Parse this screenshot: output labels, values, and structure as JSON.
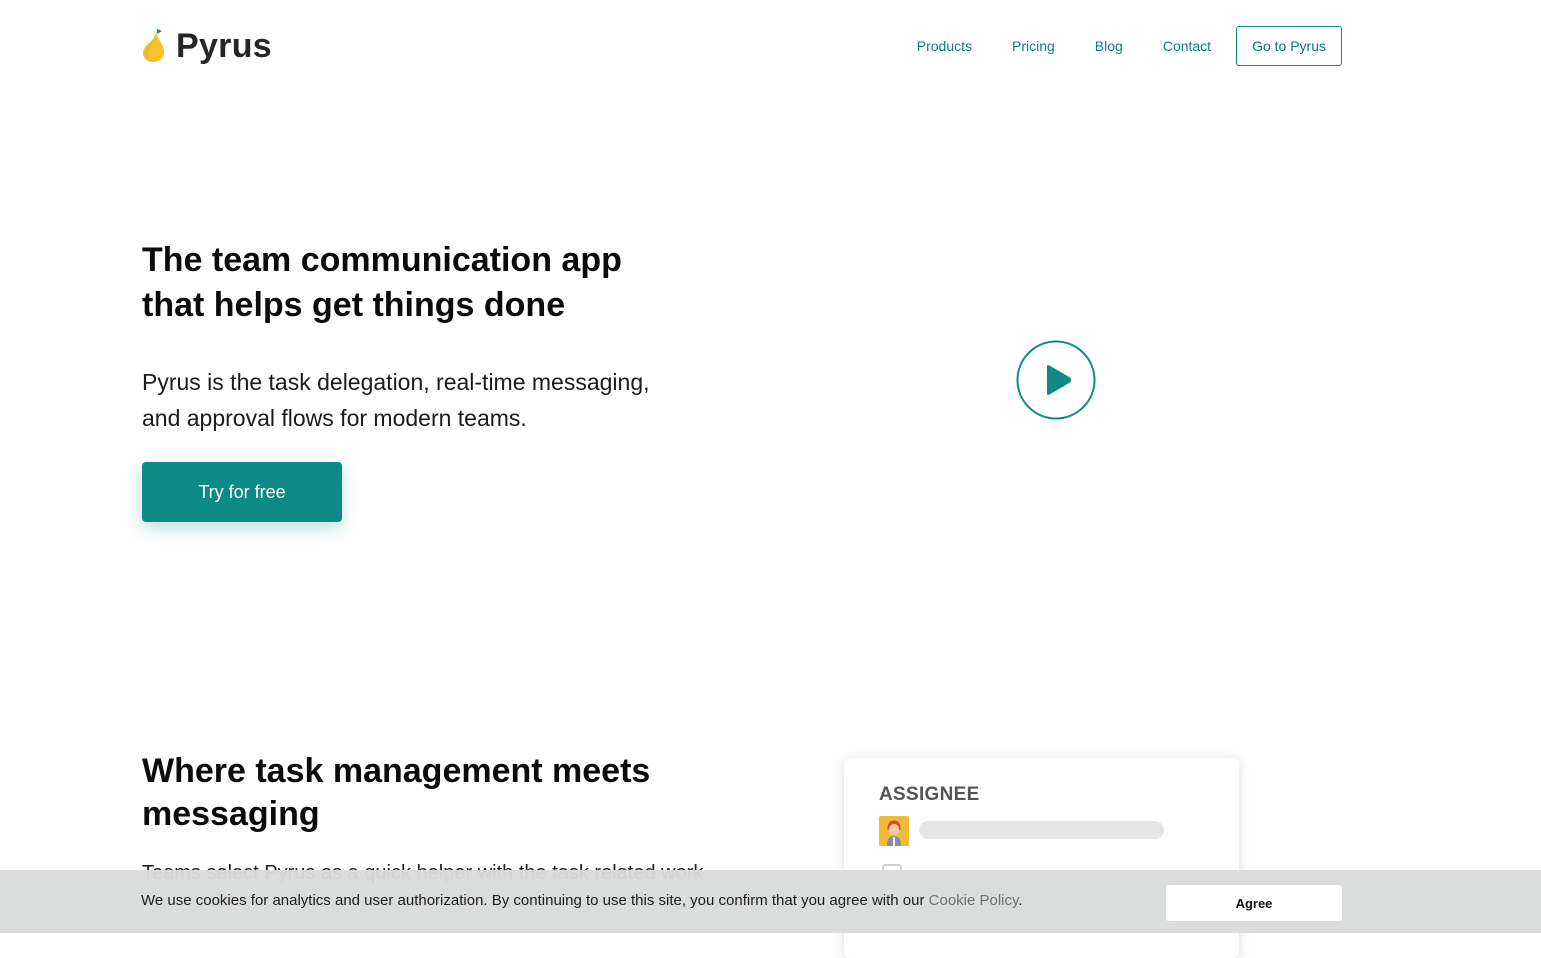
{
  "header": {
    "logo_text": "Pyrus",
    "nav": {
      "products": "Products",
      "pricing": "Pricing",
      "blog": "Blog",
      "contact": "Contact",
      "go_to": "Go to Pyrus"
    }
  },
  "hero": {
    "title_line1": "The team communication app",
    "title_line2": "that helps get things done",
    "subtitle_line1": "Pyrus is the task delegation, real-time messaging,",
    "subtitle_line2": "and approval flows for modern teams.",
    "cta": "Try for free",
    "play_icon": "play-icon"
  },
  "section": {
    "title_line1": "Where task management meets",
    "title_line2": "messaging",
    "body_partial": "Teams select Pyrus as a quick helper with the task related work",
    "card": {
      "label": "ASSIGNEE",
      "avatar_icon": "user-avatar-icon"
    }
  },
  "cookie": {
    "text": "We use cookies for analytics and user authorization. By continuing to use this site, you confirm that you agree with our ",
    "link": "Cookie Policy",
    "suffix": ".",
    "button": "Agree"
  },
  "colors": {
    "accent": "#0e8a86",
    "nav_link": "#10807b",
    "logo_pear": "#f2c230",
    "logo_leaf": "#1e8a6e",
    "text": "#0b0b0b",
    "cookie_bg": "#dadcdc"
  }
}
